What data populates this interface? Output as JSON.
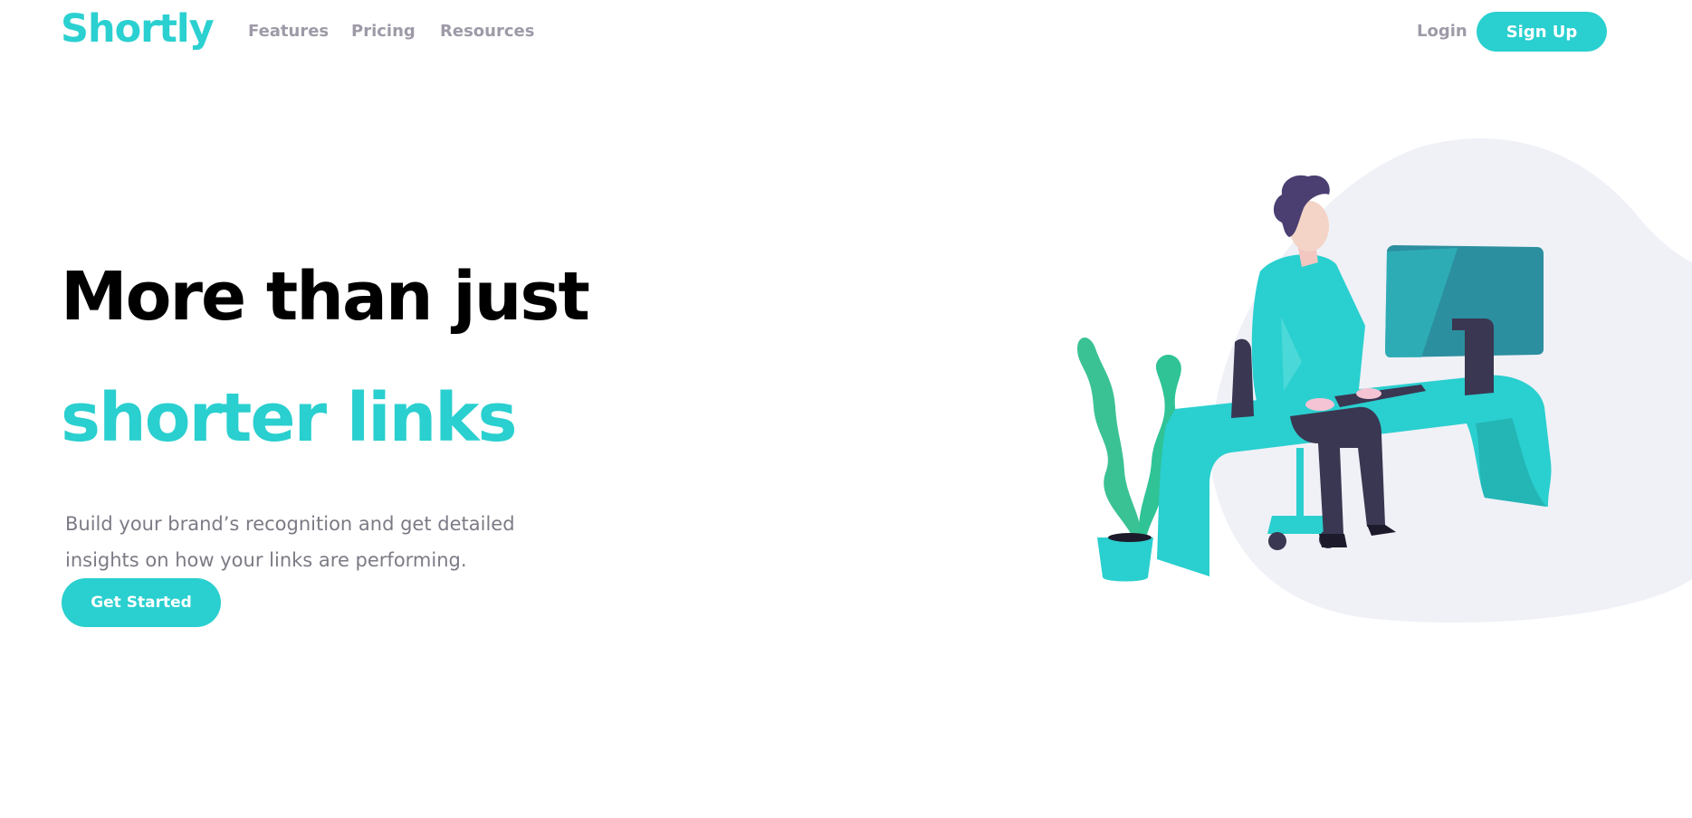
{
  "nav": {
    "logo": "Shortly",
    "links": [
      "Features",
      "Pricing",
      "Resources"
    ],
    "login": "Login",
    "signup": "Sign Up"
  },
  "hero": {
    "headline_line1": "More than just",
    "headline_line2": "shorter links",
    "subtext": "Build your brand’s recognition and get detailed insights on how your links are performing.",
    "cta": "Get Started"
  },
  "colors": {
    "accent": "#2acfcf",
    "text_dark": "#000000",
    "text_muted": "#9e9aa7",
    "blob": "#eff1f7"
  },
  "illustration": {
    "icon": "person-working-illustration"
  }
}
